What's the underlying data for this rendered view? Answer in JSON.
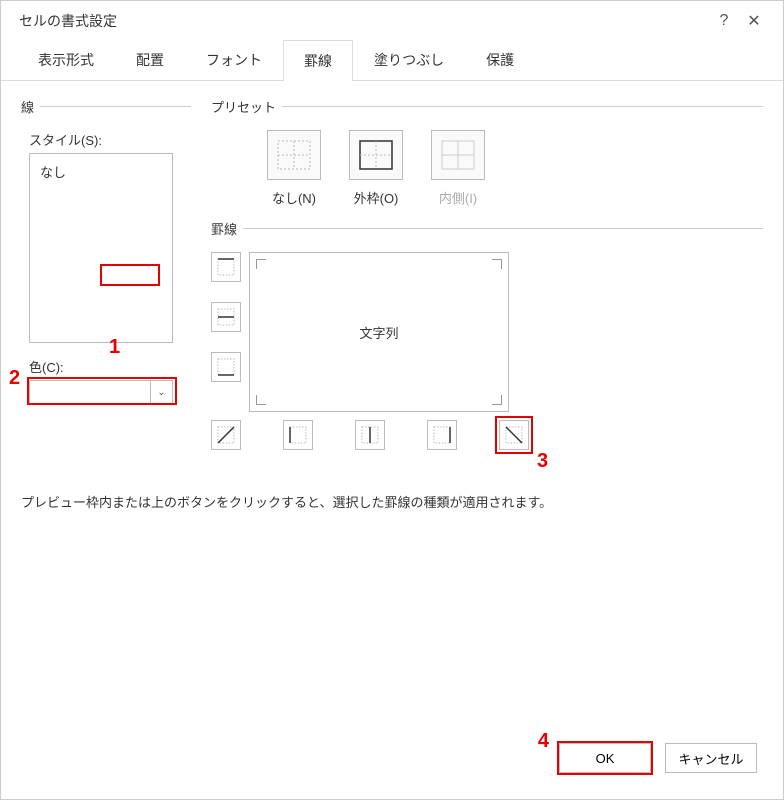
{
  "titlebar": {
    "title": "セルの書式設定"
  },
  "tabs": {
    "display": "表示形式",
    "alignment": "配置",
    "font": "フォント",
    "border": "罫線",
    "fill": "塗りつぶし",
    "protection": "保護"
  },
  "linesGroup": {
    "legend": "線"
  },
  "styleLabel": "スタイル(S):",
  "styleNone": "なし",
  "colorLabel": "色(C):",
  "presetGroup": {
    "legend": "プリセット"
  },
  "presets": {
    "none": "なし(N)",
    "outline": "外枠(O)",
    "inside": "内側(I)"
  },
  "borderGroup": {
    "legend": "罫線"
  },
  "previewText": "文字列",
  "hint": "プレビュー枠内または上のボタンをクリックすると、選択した罫線の種類が適用されます。",
  "footer": {
    "ok": "OK",
    "cancel": "キャンセル"
  },
  "annotations": {
    "1": "1",
    "2": "2",
    "3": "3",
    "4": "4"
  }
}
